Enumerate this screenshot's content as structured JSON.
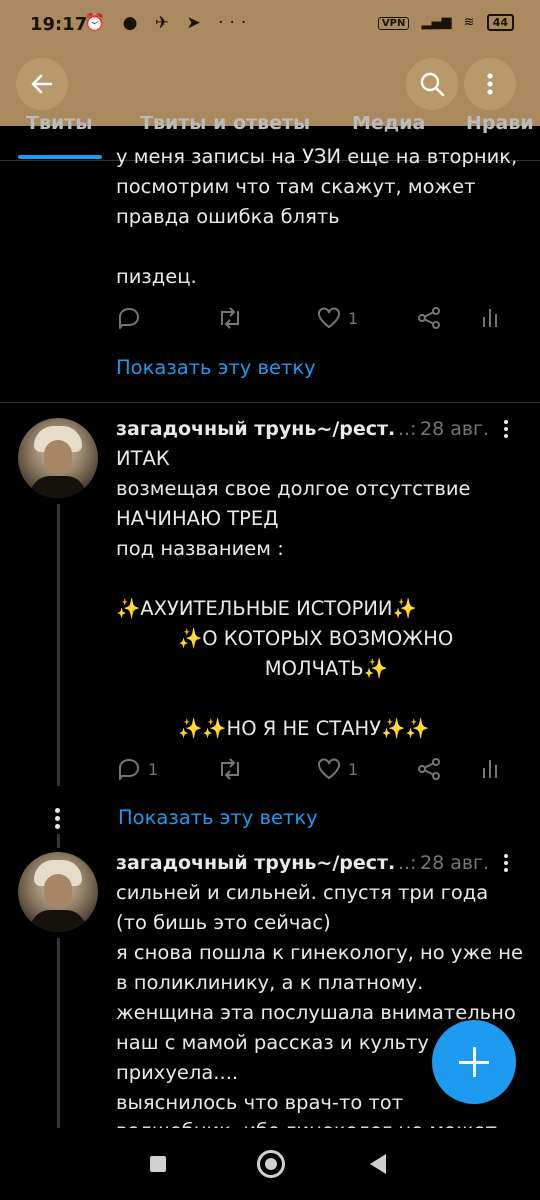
{
  "status": {
    "time": "19:17",
    "left_icons": "⏰ ● ✈ ➤ ···",
    "vpn": "VPN",
    "signal": "▂▄▆",
    "wifi": "≋",
    "battery": "44"
  },
  "tabs": [
    "Твиты",
    "Твиты и ответы",
    "Медиа",
    "Нрави"
  ],
  "tweet0": {
    "lines": [
      "у меня записы на УЗИ еще на вторник,",
      "посмотрим что там скажут, может",
      "правда ошибка блять",
      "",
      "пиздец."
    ],
    "likes": "1",
    "show_thread": "Показать эту ветку"
  },
  "tweet1": {
    "author": "загадочный трунь~/рест.",
    "ellipsis": "..:",
    "date": "28 авг.",
    "lines": [
      "ИТАК",
      "возмещая свое долгое отсутствие",
      "НАЧИНАЮ ТРЕД",
      "под названием :",
      "",
      "✨АХУИТЕЛЬНЫЕ ИСТОРИИ✨",
      "          ✨О КОТОРЫХ ВОЗМОЖНО",
      "                        МОЛЧАТЬ✨",
      "",
      "          ✨✨НО Я НЕ СТАНУ✨✨"
    ],
    "replies": "1",
    "likes": "1",
    "show_thread": "Показать эту ветку"
  },
  "tweet2": {
    "author": "загадочный трунь~/рест.",
    "ellipsis": "..:",
    "date": "28 авг.",
    "lines": [
      "сильней и сильней. спустя три года",
      "(то бишь это сейчас)",
      "я снова пошла к гинекологу, но уже не",
      "в поликлинику, а к платному.",
      "женщина эта послушала внимательно",
      "наш с мамой рассказ и культу",
      "прихуела....",
      "выяснилось что врач-то тот",
      "волшебник, ибо гинеколог не может"
    ]
  },
  "colors": {
    "appbar": "#a98a5f",
    "accent": "#1d9bf0",
    "background": "#000000",
    "muted": "#71767b"
  }
}
